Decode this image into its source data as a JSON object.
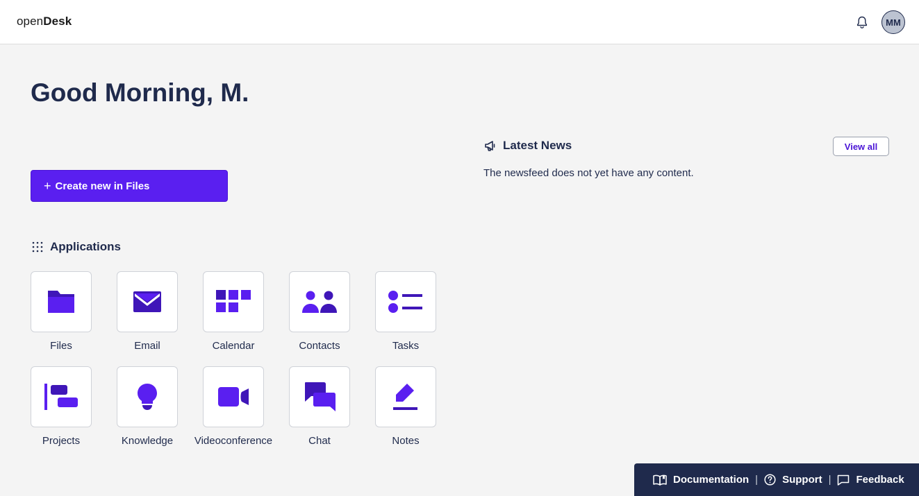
{
  "header": {
    "logo_light": "open",
    "logo_bold": "Desk",
    "notifications_icon": "bell-icon",
    "avatar_initials": "MM"
  },
  "greeting": {
    "title": "Good Morning, M."
  },
  "create_button": {
    "icon": "plus-icon",
    "label": "Create new in Files"
  },
  "applications": {
    "heading": "Applications",
    "icon": "grid-dots-icon",
    "items": [
      {
        "label": "Files",
        "icon": "folder-icon"
      },
      {
        "label": "Email",
        "icon": "envelope-icon"
      },
      {
        "label": "Calendar",
        "icon": "calendar-icon"
      },
      {
        "label": "Contacts",
        "icon": "contacts-icon"
      },
      {
        "label": "Tasks",
        "icon": "tasks-icon"
      },
      {
        "label": "Projects",
        "icon": "projects-icon"
      },
      {
        "label": "Knowledge",
        "icon": "lightbulb-icon"
      },
      {
        "label": "Videoconference",
        "icon": "video-camera-icon"
      },
      {
        "label": "Chat",
        "icon": "chat-bubbles-icon"
      },
      {
        "label": "Notes",
        "icon": "pencil-icon"
      }
    ]
  },
  "news": {
    "heading": "Latest News",
    "icon": "megaphone-icon",
    "view_all_label": "View all",
    "empty_message": "The newsfeed does not yet have any content."
  },
  "footer": {
    "links": [
      {
        "label": "Documentation",
        "icon": "book-icon"
      },
      {
        "label": "Support",
        "icon": "help-circle-icon"
      },
      {
        "label": "Feedback",
        "icon": "feedback-icon"
      }
    ],
    "separator": "|"
  },
  "colors": {
    "accent": "#5a1ff0",
    "accent_dark": "#3f16b8",
    "navy": "#1f2a4c",
    "background": "#f4f4f4"
  }
}
